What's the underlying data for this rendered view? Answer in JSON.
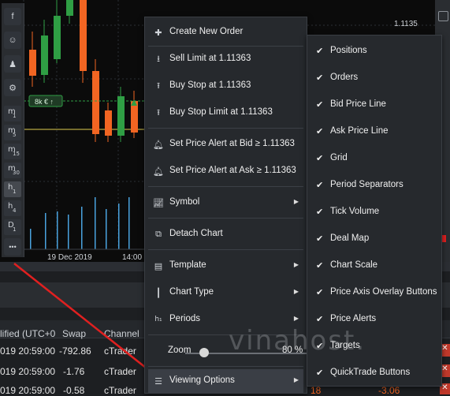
{
  "chart": {
    "price_level_label": "1.1135",
    "date_label": "19 Dec 2019",
    "time_label": "14:00",
    "position_badge": "8k € ↑"
  },
  "left_toolbar": {
    "timeframes": [
      {
        "main": "m",
        "sub": "1"
      },
      {
        "main": "m",
        "sub": "5"
      },
      {
        "main": "m",
        "sub": "15"
      },
      {
        "main": "m",
        "sub": "30"
      },
      {
        "main": "h",
        "sub": "1"
      },
      {
        "main": "h",
        "sub": "4"
      },
      {
        "main": "D",
        "sub": "1"
      }
    ],
    "more_label": "•••"
  },
  "bottom_panel": {
    "headers": {
      "modified": "lified (UTC+0",
      "swap": "Swap",
      "channel": "Channel"
    },
    "rows": [
      {
        "modified": "019 20:59:00",
        "swap": "-792.86",
        "channel": "cTrader"
      },
      {
        "modified": "019 20:59:00",
        "swap": "-1.76",
        "channel": "cTrader"
      },
      {
        "modified": "019 20:59:00",
        "swap": "-0.58",
        "channel": "cTrader"
      }
    ],
    "right_values": [
      "18",
      "-3.06"
    ]
  },
  "context_menu": {
    "items": [
      {
        "label": "Create New Order",
        "icon": "plus-icon"
      },
      {
        "label": "Sell Limit at 1.11363",
        "icon": "arrow-down-icon"
      },
      {
        "label": "Buy Stop at 1.11363",
        "icon": "arrow-up-icon"
      },
      {
        "label": "Buy Stop Limit at 1.11363",
        "icon": "arrow-up-icon"
      },
      {
        "label": "Set Price Alert at Bid ≥ 1.11363",
        "icon": "bell-icon"
      },
      {
        "label": "Set Price Alert at Ask ≥ 1.11363",
        "icon": "bell-icon"
      },
      {
        "label": "Symbol",
        "icon": "chart-icon"
      },
      {
        "label": "Detach Chart",
        "icon": "detach-icon"
      },
      {
        "label": "Template",
        "icon": "template-icon"
      },
      {
        "label": "Chart Type",
        "icon": "candles-icon"
      },
      {
        "label": "Periods",
        "icon": "periods-icon"
      },
      {
        "label": "Zoom",
        "value": "80 %"
      },
      {
        "label": "Viewing Options",
        "icon": "list-icon"
      }
    ],
    "zoom_percent": 80
  },
  "viewing_options": {
    "items": [
      "Positions",
      "Orders",
      "Bid Price Line",
      "Ask Price Line",
      "Grid",
      "Period Separators",
      "Tick Volume",
      "Deal Map",
      "Chart Scale",
      "Price Axis Overlay Buttons",
      "Price Alerts",
      "Targets",
      "QuickTrade Buttons"
    ]
  },
  "watermark": "vinahost.",
  "colors": {
    "bull": "#2f9e44",
    "bear": "#f26522",
    "volume": "#4aa3df",
    "bid_line": "#b5a642",
    "arrow": "#e02020"
  }
}
